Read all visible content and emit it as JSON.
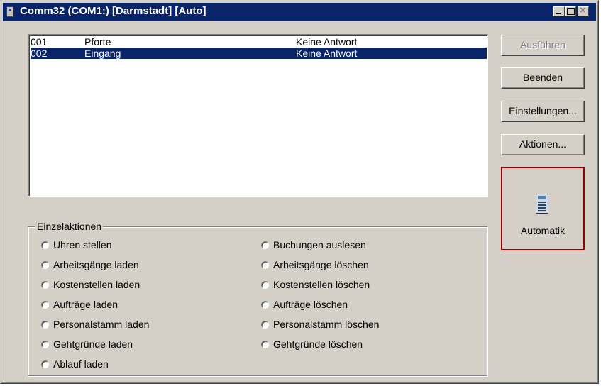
{
  "window": {
    "title": "Comm32 (COM1:) [Darmstadt] [Auto]"
  },
  "list": {
    "rows": [
      {
        "nr": "001",
        "name": "Pforte",
        "status": "Keine Antwort"
      },
      {
        "nr": "002",
        "name": "Eingang",
        "status": "Keine Antwort"
      }
    ],
    "selected_row": "002"
  },
  "buttons": {
    "ausfuehren": "Ausführen",
    "beenden": "Beenden",
    "einstellungen": "Einstellungen...",
    "aktionen": "Aktionen...",
    "automatik": "Automatik"
  },
  "einzelaktionen": {
    "title": "Einzelaktionen",
    "left": [
      "Uhren stellen",
      "Arbeitsgänge laden",
      "Kostenstellen laden",
      "Aufträge laden",
      "Personalstamm laden",
      "Gehtgründe laden",
      "Ablauf laden"
    ],
    "right": [
      "Buchungen auslesen",
      "Arbeitsgänge löschen",
      "Kostenstellen löschen",
      "Aufträge löschen",
      "Personalstamm löschen",
      "Gehtgründe löschen"
    ]
  },
  "colors": {
    "titlebar": "#0a246a",
    "selection": "#0a246a",
    "face": "#d4d0c8",
    "automatik_border": "#9b0000"
  }
}
